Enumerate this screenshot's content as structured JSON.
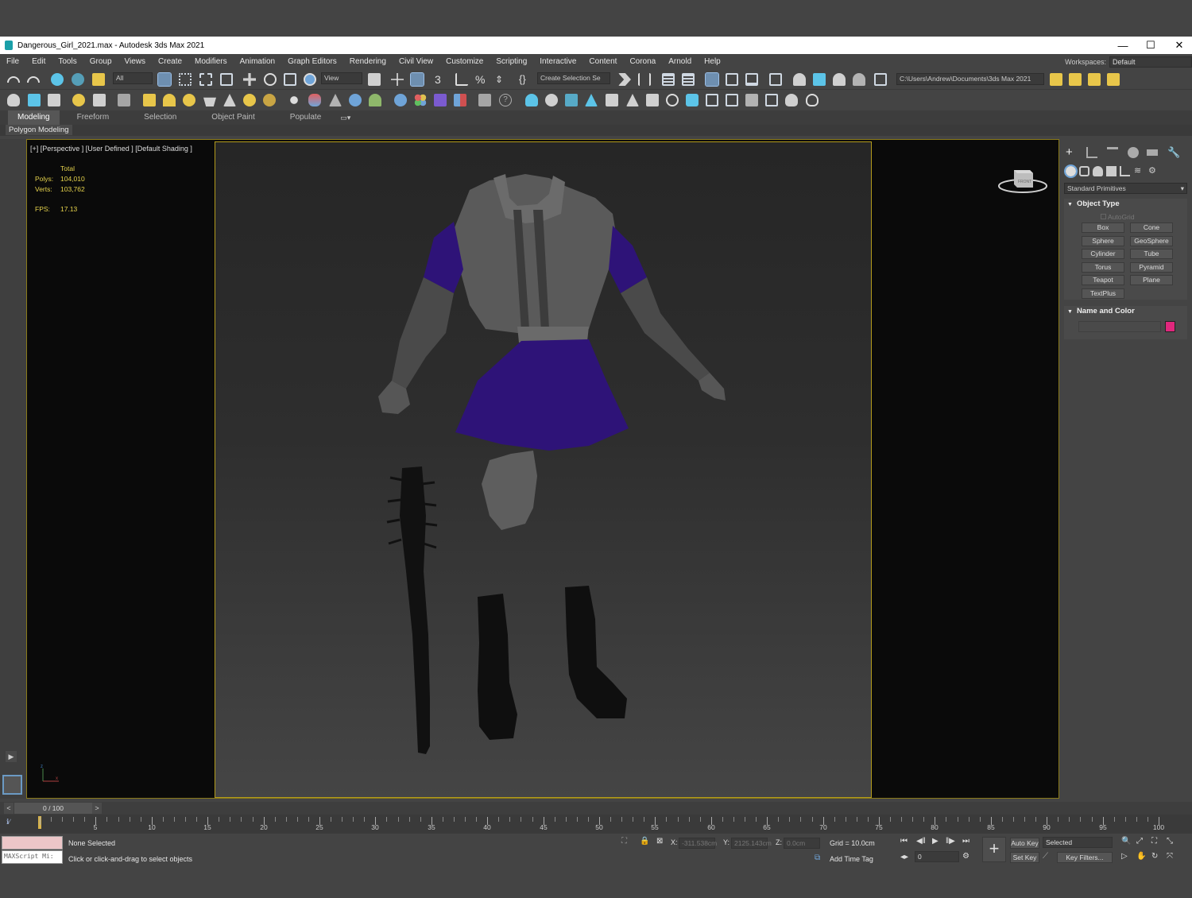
{
  "window": {
    "title": "Dangerous_Girl_2021.max - Autodesk 3ds Max 2021",
    "controls": [
      "—",
      "☐",
      "✕"
    ]
  },
  "menu": [
    "File",
    "Edit",
    "Tools",
    "Group",
    "Views",
    "Create",
    "Modifiers",
    "Animation",
    "Graph Editors",
    "Rendering",
    "Civil View",
    "Customize",
    "Scripting",
    "Interactive",
    "Content",
    "Corona",
    "Arnold",
    "Help"
  ],
  "workspaces": {
    "label": "Workspaces:",
    "value": "Default"
  },
  "toolbar": {
    "filter_value": "All",
    "refcoord_value": "View",
    "selection_set_value": "Create Selection Se",
    "project_path": "C:\\Users\\Andrew\\Documents\\3ds Max 2021"
  },
  "ribbon": {
    "tabs": [
      "Modeling",
      "Freeform",
      "Selection",
      "Object Paint",
      "Populate"
    ],
    "active_tab": "Modeling",
    "panel_label": "Polygon Modeling"
  },
  "viewport": {
    "label": "[+] [Perspective ] [User Defined ] [Default Shading ]",
    "stats": {
      "header": "Total",
      "polys_label": "Polys:",
      "polys_value": "104,010",
      "verts_label": "Verts:",
      "verts_value": "103,762",
      "fps_label": "FPS:",
      "fps_value": "17.13"
    },
    "viewcube_label": "FRONT"
  },
  "command_panel": {
    "category_dropdown": "Standard Primitives",
    "object_type": {
      "title": "Object Type",
      "autogrid_label": "AutoGrid",
      "buttons": [
        "Box",
        "Cone",
        "Sphere",
        "GeoSphere",
        "Cylinder",
        "Tube",
        "Torus",
        "Pyramid",
        "Teapot",
        "Plane",
        "TextPlus"
      ]
    },
    "name_and_color": {
      "title": "Name and Color",
      "name_value": "",
      "color": "#e0277d"
    }
  },
  "timeline": {
    "slider_label": "0 / 100",
    "ticks": [
      "0",
      "5",
      "10",
      "15",
      "20",
      "25",
      "30",
      "35",
      "40",
      "45",
      "50",
      "55",
      "60",
      "65",
      "70",
      "75",
      "80",
      "85",
      "90",
      "95",
      "100"
    ]
  },
  "status": {
    "maxscript_placeholder": "MAXScript Mi:",
    "selection_status": "None Selected",
    "prompt": "Click or click-and-drag to select objects",
    "x_label": "X:",
    "x_value": "-311.538cm",
    "y_label": "Y:",
    "y_value": "2125.143cm",
    "z_label": "Z:",
    "z_value": "0.0cm",
    "grid": "Grid = 10.0cm",
    "add_time_tag": "Add Time Tag",
    "auto_key": "Auto Key",
    "set_key": "Set Key",
    "key_mode_value": "Selected",
    "key_filters": "Key Filters...",
    "frame_value": "0"
  },
  "colors": {
    "accent_blue": "#6fa4d8",
    "viewport_border": "#b39b1b",
    "stats_yellow": "#e6d34c",
    "skirt_purple": "#2e1378"
  }
}
